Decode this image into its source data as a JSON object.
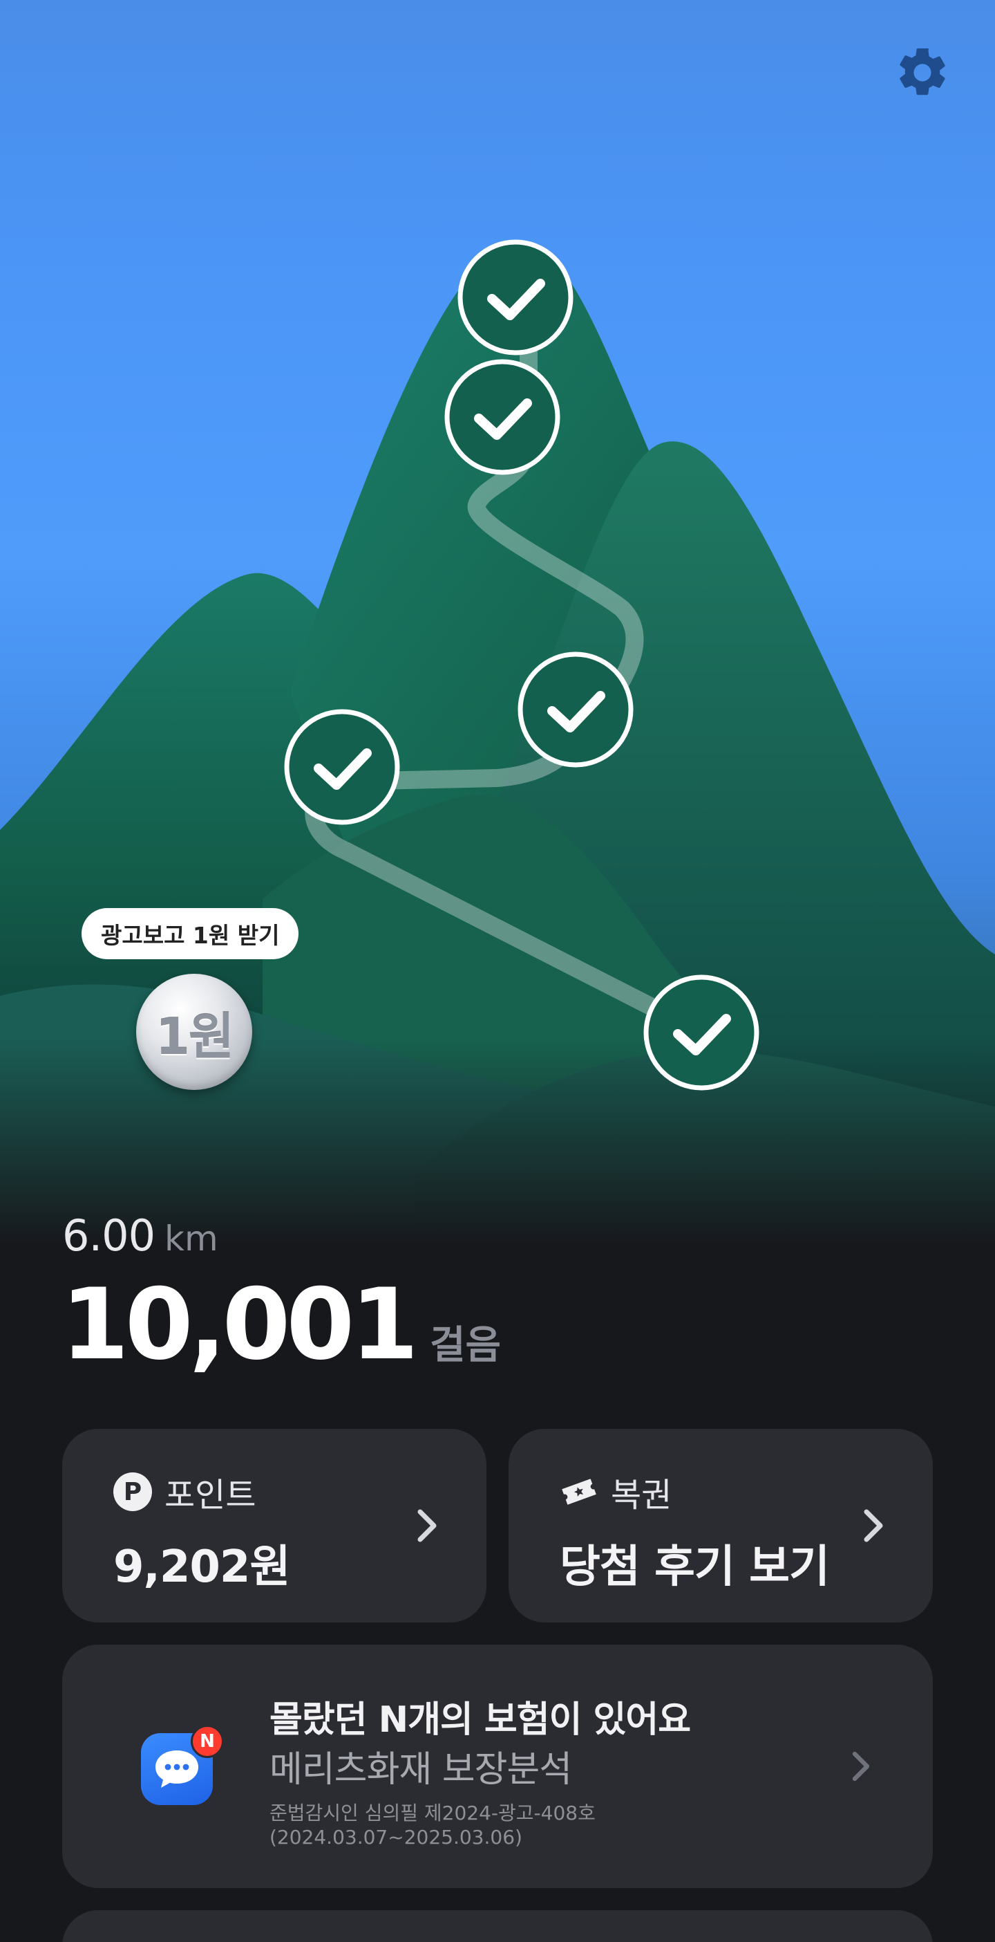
{
  "header": {
    "settings_icon": "gear-icon"
  },
  "map": {
    "checkpoints": [
      {
        "state": "completed",
        "icon": "check-icon"
      },
      {
        "state": "completed",
        "icon": "check-icon"
      },
      {
        "state": "completed",
        "icon": "check-icon"
      },
      {
        "state": "completed",
        "icon": "check-icon"
      },
      {
        "state": "completed",
        "icon": "check-icon"
      }
    ],
    "ad_reward_label": "광고보고 1원 받기",
    "coin_label": "1원"
  },
  "stats": {
    "distance_value": "6.00",
    "distance_unit": "km",
    "steps_value": "10,001",
    "steps_unit": "걸음"
  },
  "cards": {
    "point": {
      "icon": "p-coin-icon",
      "label": "포인트",
      "value": "9,202원"
    },
    "lotto": {
      "icon": "ticket-icon",
      "label": "복권",
      "value": "당첨 후기 보기"
    }
  },
  "ad_banner": {
    "icon": "chat-bubble-icon",
    "badge": "N",
    "title": "몰랐던 N개의 보험이 있어요",
    "subtitle": "메리츠화재 보장분석",
    "note_line1": "준법감시인 심의필 제2024-광고-408호",
    "note_line2": "(2024.03.07~2025.03.06)"
  },
  "colors": {
    "sky": "#4b95f6",
    "mountain": "#166b58",
    "background": "#17181c",
    "card": "#2b2c32",
    "accent_blue": "#2f74f0",
    "badge_red": "#ff3b30"
  }
}
